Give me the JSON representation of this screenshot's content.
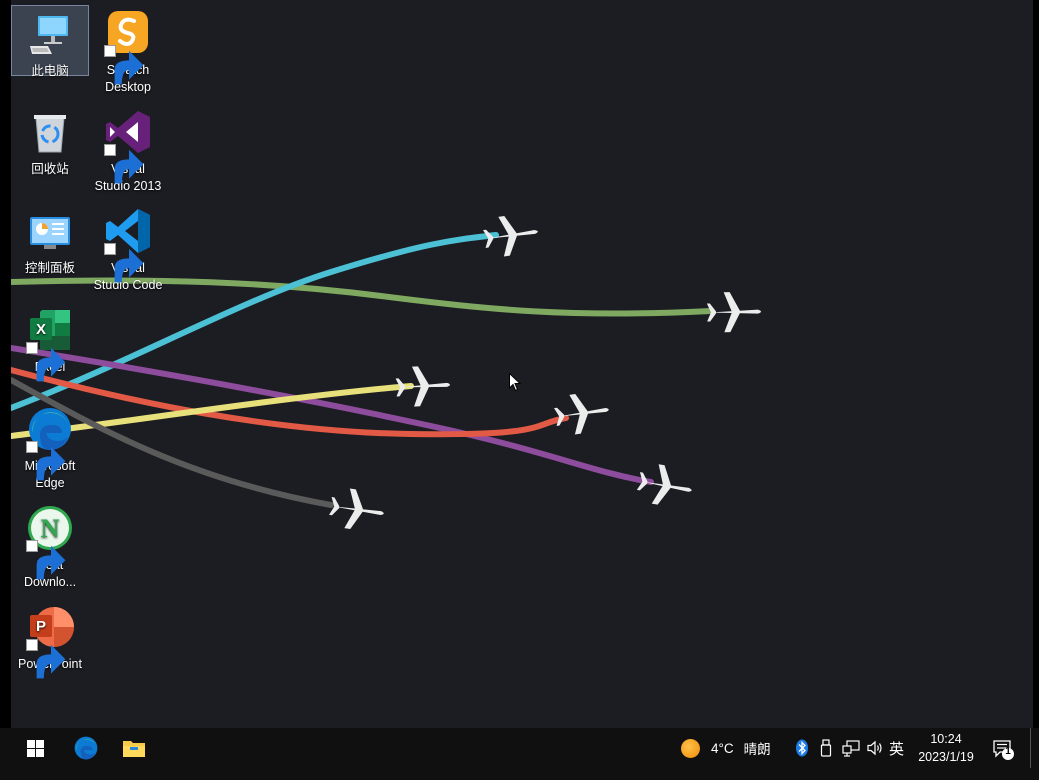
{
  "desktop": {
    "icons": [
      {
        "label": "此电脑",
        "icon": "this-pc-icon"
      },
      {
        "label": "Scratch\nDesktop",
        "icon": "scratch-icon"
      },
      {
        "label": "回收站",
        "icon": "recycle-bin-icon"
      },
      {
        "label": "Visual\nStudio 2013",
        "icon": "visual-studio-icon"
      },
      {
        "label": "控制面板",
        "icon": "control-panel-icon"
      },
      {
        "label": "Visual\nStudio Code",
        "icon": "vscode-icon"
      },
      {
        "label": "Excel",
        "icon": "excel-icon"
      },
      {
        "label": "Microsoft\nEdge",
        "icon": "edge-icon"
      },
      {
        "label": "Neat\nDownlo...",
        "icon": "neat-download-icon"
      },
      {
        "label": "PowerPoint",
        "icon": "powerpoint-icon"
      }
    ],
    "wallpaper": {
      "trails": [
        "#7fa860",
        "#4cc0d4",
        "#8e4c9c",
        "#e25a45",
        "#e8e07a",
        "#5a5a5a"
      ]
    }
  },
  "taskbar": {
    "pinned": [
      "start-icon",
      "edge-icon",
      "file-explorer-icon"
    ],
    "weather": {
      "temp": "4°C",
      "condition": "晴朗"
    },
    "ime": "英",
    "clock": {
      "time": "10:24",
      "date": "2023/1/19"
    },
    "notifications": {
      "count": "1"
    }
  },
  "colors": {
    "desktop_bg": "#1b1d22",
    "taskbar_bg": "#101010",
    "accent": "#0078d7"
  }
}
